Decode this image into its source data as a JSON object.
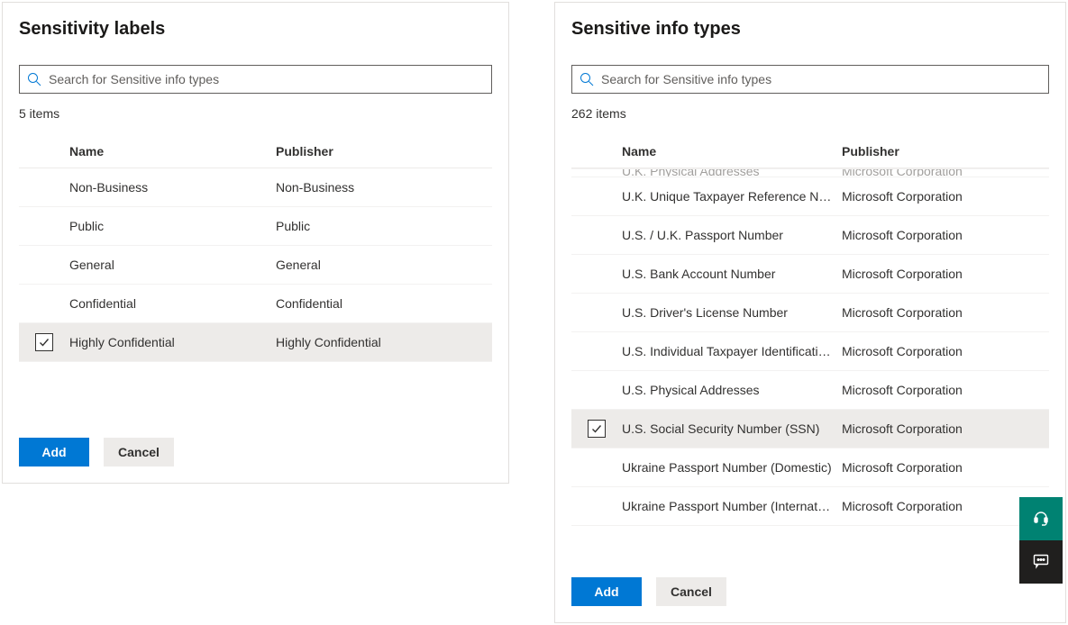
{
  "leftPanel": {
    "title": "Sensitivity labels",
    "searchPlaceholder": "Search for Sensitive info types",
    "itemCount": "5 items",
    "columns": {
      "name": "Name",
      "publisher": "Publisher"
    },
    "rows": [
      {
        "name": "Non-Business",
        "publisher": "Non-Business",
        "selected": false
      },
      {
        "name": "Public",
        "publisher": "Public",
        "selected": false
      },
      {
        "name": "General",
        "publisher": "General",
        "selected": false
      },
      {
        "name": "Confidential",
        "publisher": "Confidential",
        "selected": false
      },
      {
        "name": "Highly Confidential",
        "publisher": "Highly Confidential",
        "selected": true
      }
    ],
    "addLabel": "Add",
    "cancelLabel": "Cancel"
  },
  "rightPanel": {
    "title": "Sensitive info types",
    "searchPlaceholder": "Search for Sensitive info types",
    "itemCount": "262 items",
    "columns": {
      "name": "Name",
      "publisher": "Publisher"
    },
    "partialRow": {
      "name": "U.K. Physical Addresses",
      "publisher": "Microsoft Corporation"
    },
    "rows": [
      {
        "name": "U.K. Unique Taxpayer Reference Number",
        "publisher": "Microsoft Corporation",
        "selected": false
      },
      {
        "name": "U.S. / U.K. Passport Number",
        "publisher": "Microsoft Corporation",
        "selected": false
      },
      {
        "name": "U.S. Bank Account Number",
        "publisher": "Microsoft Corporation",
        "selected": false
      },
      {
        "name": "U.S. Driver's License Number",
        "publisher": "Microsoft Corporation",
        "selected": false
      },
      {
        "name": "U.S. Individual Taxpayer Identification Number (ITIN)",
        "publisher": "Microsoft Corporation",
        "selected": false
      },
      {
        "name": "U.S. Physical Addresses",
        "publisher": "Microsoft Corporation",
        "selected": false
      },
      {
        "name": "U.S. Social Security Number (SSN)",
        "publisher": "Microsoft Corporation",
        "selected": true
      },
      {
        "name": "Ukraine Passport Number (Domestic)",
        "publisher": "Microsoft Corporation",
        "selected": false
      },
      {
        "name": "Ukraine Passport Number (International)",
        "publisher": "Microsoft Corporation",
        "selected": false
      }
    ],
    "addLabel": "Add",
    "cancelLabel": "Cancel"
  }
}
